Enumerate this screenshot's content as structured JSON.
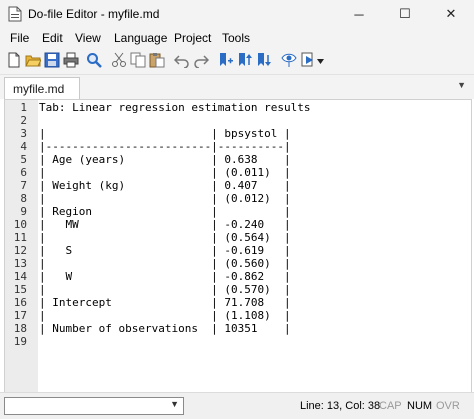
{
  "window": {
    "title": "Do-file Editor - myfile.md",
    "controls": {
      "minimize": "─",
      "maximize": "☐",
      "close": "✕"
    }
  },
  "menu": [
    "File",
    "Edit",
    "View",
    "Language",
    "Project",
    "Tools"
  ],
  "toolbar": {
    "icons": [
      "new-file-icon",
      "open-folder-icon",
      "save-icon",
      "print-icon",
      "find-icon",
      "cut-icon",
      "copy-icon",
      "paste-icon",
      "undo-icon",
      "redo-icon",
      "bookmark-toggle-icon",
      "bookmark-prev-icon",
      "bookmark-next-icon",
      "preview-icon",
      "execute-icon",
      "execute-dropdown-icon"
    ]
  },
  "tab": {
    "label": "myfile.md",
    "dropdown": "▼"
  },
  "editor": {
    "lines": [
      {
        "n": "1",
        "text": "Tab: Linear regression estimation results"
      },
      {
        "n": "2",
        "text": ""
      },
      {
        "n": "3",
        "text": "|                         | bpsystol |"
      },
      {
        "n": "4",
        "text": "|-------------------------|----------|"
      },
      {
        "n": "5",
        "text": "| Age (years)             | 0.638    |"
      },
      {
        "n": "6",
        "text": "|                         | (0.011)  |"
      },
      {
        "n": "7",
        "text": "| Weight (kg)             | 0.407    |"
      },
      {
        "n": "8",
        "text": "|                         | (0.012)  |"
      },
      {
        "n": "9",
        "text": "| Region                  |          |"
      },
      {
        "n": "10",
        "text": "|   MW                    | -0.240   |"
      },
      {
        "n": "11",
        "text": "|                         | (0.564)  |"
      },
      {
        "n": "12",
        "text": "|   S                     | -0.619   |"
      },
      {
        "n": "13",
        "text": "|                         | (0.560)  |"
      },
      {
        "n": "14",
        "text": "|   W                     | -0.862   |"
      },
      {
        "n": "15",
        "text": "|                         | (0.570)  |"
      },
      {
        "n": "16",
        "text": "| Intercept               | 71.708   |"
      },
      {
        "n": "17",
        "text": "|                         | (1.108)  |"
      },
      {
        "n": "18",
        "text": "| Number of observations  | 10351    |"
      },
      {
        "n": "19",
        "text": ""
      }
    ]
  },
  "status": {
    "command_dropdown": "▼",
    "position": "Line: 13, Col: 38",
    "caps": "CAP",
    "num": "NUM",
    "ovr": "OVR"
  },
  "colors": {
    "chrome": "#f3f3f3",
    "gutter": "#ececec",
    "status_active": "#000000",
    "status_inactive": "#9a9a9a",
    "toolbar_blue": "#2b6cc4"
  }
}
